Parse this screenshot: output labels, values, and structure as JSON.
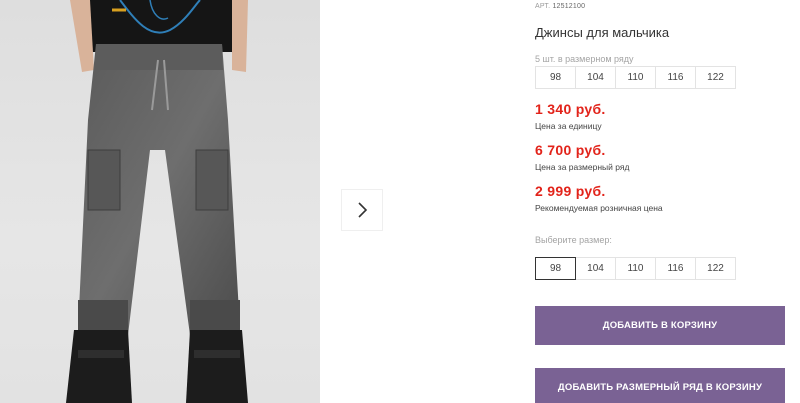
{
  "product": {
    "article_label": "АРТ.",
    "article_number": "12512100",
    "title": "Джинсы для мальчика"
  },
  "size_run": {
    "hint": "5 шт. в размерном ряду",
    "sizes": [
      "98",
      "104",
      "110",
      "116",
      "122"
    ]
  },
  "prices": [
    {
      "value": "1 340 руб.",
      "caption": "Цена за единицу"
    },
    {
      "value": "6 700 руб.",
      "caption": "Цена за размерный ряд"
    },
    {
      "value": "2 999 руб.",
      "caption": "Рекомендуемая розничная цена"
    }
  ],
  "size_select": {
    "hint": "Выберите размер:",
    "sizes": [
      "98",
      "104",
      "110",
      "116",
      "122"
    ],
    "selected": "98"
  },
  "buttons": {
    "add_to_cart": "ДОБАВИТЬ В КОРЗИНУ",
    "add_size_run_to_cart": "ДОБАВИТЬ РАЗМЕРНЫЙ РЯД В КОРЗИНУ"
  },
  "colors": {
    "price_red": "#e2231a",
    "button_purple": "#7a6294"
  },
  "icons": {
    "next": "chevron-right-icon"
  }
}
